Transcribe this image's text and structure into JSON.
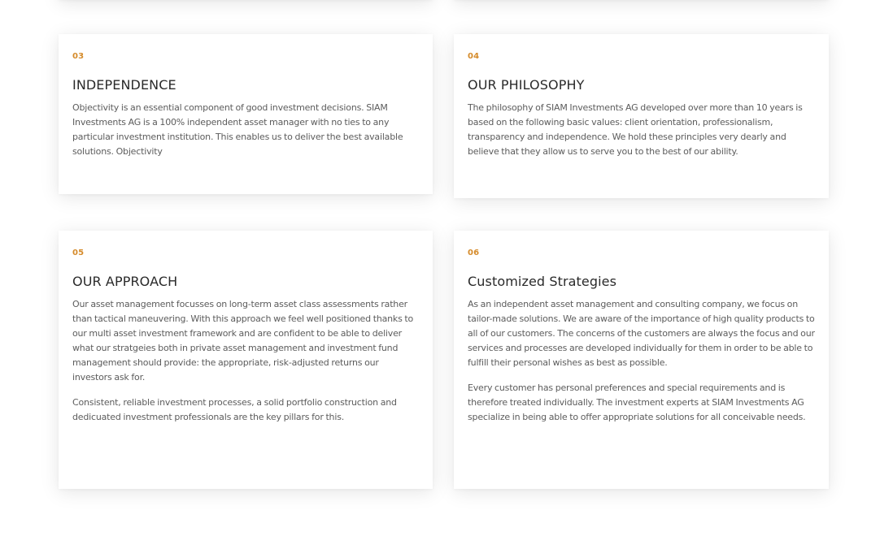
{
  "cards": [
    {
      "number": "03",
      "title": "INDEPENDENCE",
      "paragraphs": [
        "Objectivity is an essential component of good investment decisions. SIAM Investments AG is a 100% independent asset manager with no ties to any particular investment institution. This enables us to deliver the best available solutions. Objectivity"
      ]
    },
    {
      "number": "04",
      "title": "OUR PHILOSOPHY",
      "paragraphs": [
        "The philosophy of SIAM Investments AG developed over more than 10 years is based on the following basic values: client orientation, professionalism, transparency and independence. We hold these principles very dearly and believe that they allow us to serve you to the best of our ability."
      ]
    },
    {
      "number": "05",
      "title": "OUR APPROACH",
      "paragraphs": [
        "Our asset management focusses on long-term asset class assessments rather than tactical maneuvering. With this approach we feel well positioned thanks to our multi asset investment framework and are confident to be able to deliver what our stratgeies both in private asset management and investment fund management should provide: the appropriate, risk-adjusted returns our investors ask for.",
        "Consistent, reliable investment processes, a solid portfolio construction and dedicuated investment professionals are the key pillars for this."
      ]
    },
    {
      "number": "06",
      "title": "Customized Strategies",
      "paragraphs": [
        "As an independent asset management and consulting company, we focus on tailor-made solutions. We are aware of the importance of high quality products to all of our customers. The concerns of the customers are always the focus and our services and processes are developed individually for them in order to be able to fulfill their personal wishes as best as possible.",
        "Every customer has personal preferences and special requirements and is therefore treated individually. The investment experts at SIAM Investments AG specialize in being able to offer appropriate solutions for all conceivable needs."
      ]
    }
  ],
  "colors": {
    "accent": "#d58b2b",
    "title": "#2a2a2a",
    "body_text": "#5c5c5c",
    "background": "#ffffff"
  }
}
